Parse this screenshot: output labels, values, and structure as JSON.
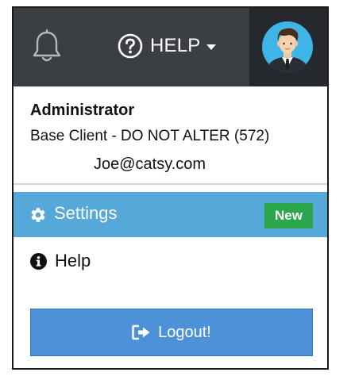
{
  "header": {
    "bell_icon": "bell-icon",
    "help_label": "HELP",
    "help_icon": "question-circle-icon",
    "avatar_icon": "user-avatar-icon"
  },
  "user": {
    "role": "Administrator",
    "client": "Base Client - DO NOT ALTER (572)",
    "email": "Joe@catsy.com"
  },
  "menu": {
    "settings": {
      "label": "Settings",
      "icon": "gear-icon",
      "badge": "New"
    },
    "help": {
      "label": "Help",
      "icon": "info-circle-icon"
    }
  },
  "logout": {
    "label": "Logout!",
    "icon": "sign-out-icon"
  },
  "colors": {
    "topbar": "#3b3e43",
    "avatar_bg": "#25282c",
    "settings_bg": "#55a8d8",
    "badge_bg": "#2ca64a",
    "logout_bg": "#4d92d9"
  }
}
